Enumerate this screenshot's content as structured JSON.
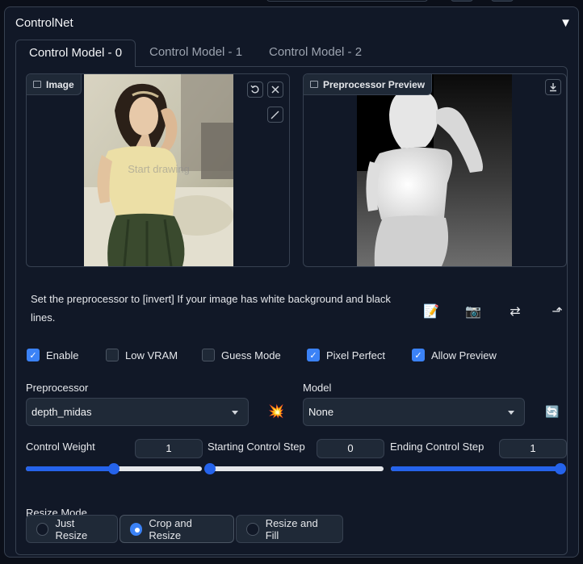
{
  "accordion": {
    "title": "ControlNet",
    "toggle_glyph": "▼"
  },
  "tabs": [
    {
      "label": "Control Model - 0",
      "active": true
    },
    {
      "label": "Control Model - 1",
      "active": false
    },
    {
      "label": "Control Model - 2",
      "active": false
    }
  ],
  "image_panel": {
    "label": "Image",
    "overlay_text": "Start drawing"
  },
  "preview_panel": {
    "label": "Preprocessor Preview"
  },
  "hint_text": "Set the preprocessor to [invert] If your image has white background and black lines.",
  "tools": [
    {
      "icon": "memo-icon",
      "glyph": "📝"
    },
    {
      "icon": "camera-icon",
      "glyph": "📷"
    },
    {
      "icon": "swap-icon",
      "glyph": "⇄"
    },
    {
      "icon": "send-icon",
      "glyph": "⬏"
    }
  ],
  "checkboxes": [
    {
      "label": "Enable",
      "checked": true
    },
    {
      "label": "Low VRAM",
      "checked": false
    },
    {
      "label": "Guess Mode",
      "checked": false
    },
    {
      "label": "Pixel Perfect",
      "checked": true
    },
    {
      "label": "Allow Preview",
      "checked": true
    }
  ],
  "preprocessor": {
    "label": "Preprocessor",
    "value": "depth_midas",
    "run_icon_glyph": "💥"
  },
  "model": {
    "label": "Model",
    "value": "None",
    "refresh_icon_glyph": "🔄"
  },
  "sliders": [
    {
      "label": "Control Weight",
      "value": "1",
      "fraction": 0.5
    },
    {
      "label": "Starting Control Step",
      "value": "0",
      "fraction": 0.0
    },
    {
      "label": "Ending Control Step",
      "value": "1",
      "fraction": 1.0
    }
  ],
  "resize_mode": {
    "label": "Resize Mode",
    "options": [
      {
        "label": "Just Resize",
        "selected": false
      },
      {
        "label": "Crop and Resize",
        "selected": true
      },
      {
        "label": "Resize and Fill",
        "selected": false
      }
    ]
  },
  "colors": {
    "accent": "#3b82f6",
    "background": "#0b0f19",
    "panel": "#111827",
    "border": "#374151"
  }
}
